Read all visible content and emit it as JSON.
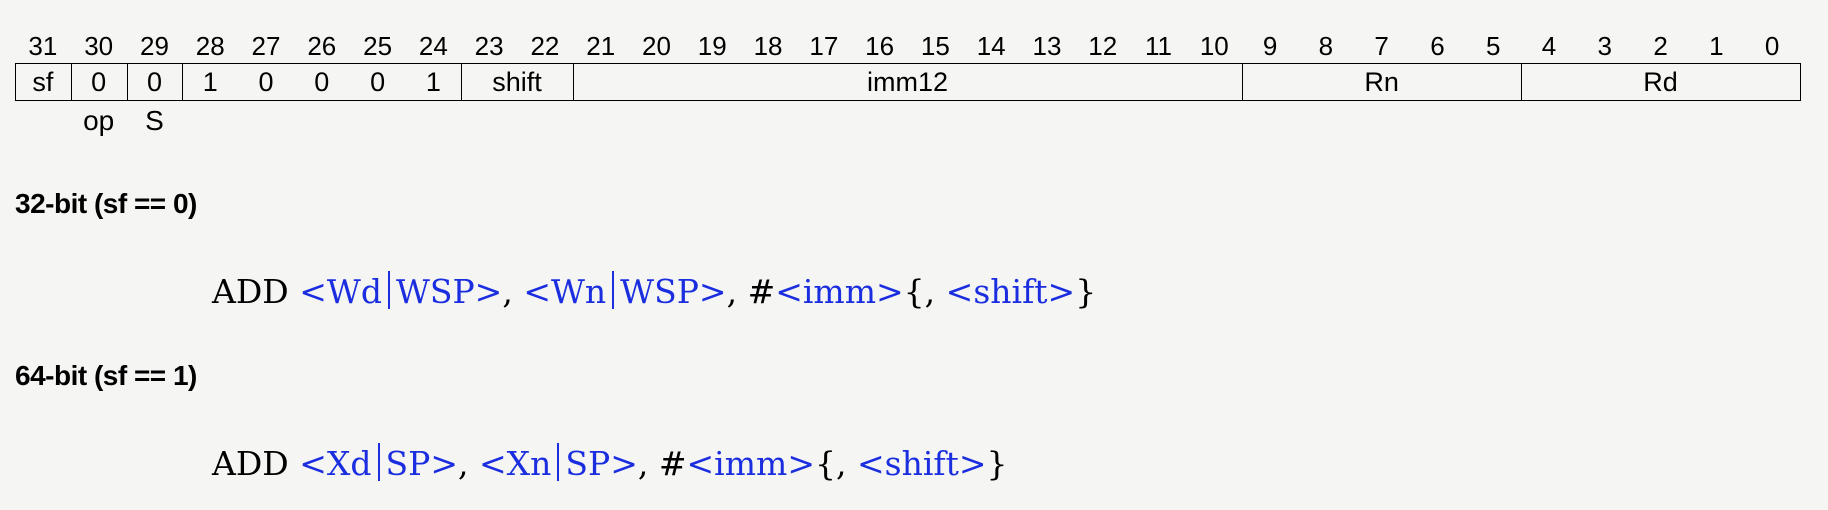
{
  "bit_numbers": [
    "31",
    "30",
    "29",
    "28",
    "27",
    "26",
    "25",
    "24",
    "23",
    "22",
    "21",
    "20",
    "19",
    "18",
    "17",
    "16",
    "15",
    "14",
    "13",
    "12",
    "11",
    "10",
    "9",
    "8",
    "7",
    "6",
    "5",
    "4",
    "3",
    "2",
    "1",
    "0"
  ],
  "encoding_fields": [
    {
      "id": "sf",
      "label": "sf"
    },
    {
      "id": "op",
      "label": "0"
    },
    {
      "id": "s",
      "label": "0"
    },
    {
      "id": "b28",
      "label": "1"
    },
    {
      "id": "b27",
      "label": "0"
    },
    {
      "id": "b26",
      "label": "0"
    },
    {
      "id": "b25",
      "label": "0"
    },
    {
      "id": "b24",
      "label": "1"
    },
    {
      "id": "shift",
      "label": "shift"
    },
    {
      "id": "imm12",
      "label": "imm12"
    },
    {
      "id": "rn",
      "label": "Rn"
    },
    {
      "id": "rd",
      "label": "Rd"
    }
  ],
  "field_sublabels": {
    "op": "op",
    "s": "S"
  },
  "variants": [
    {
      "heading": "32-bit (sf == 0)",
      "syntax": {
        "mnemonic": "ADD",
        "rd_a": "<Wd",
        "rd_b": "WSP>",
        "sep1": ",",
        "rn_a": "<Wn",
        "rn_b": "WSP>",
        "sep2": ",",
        "hash": "#",
        "imm": "<imm>",
        "opt_open": "{,",
        "shift": "<shift>",
        "opt_close": "}"
      }
    },
    {
      "heading": "64-bit (sf == 1)",
      "syntax": {
        "mnemonic": "ADD",
        "rd_a": "<Xd",
        "rd_b": "SP>",
        "sep1": ",",
        "rn_a": "<Xn",
        "rn_b": "SP>",
        "sep2": ",",
        "hash": "#",
        "imm": "<imm>",
        "opt_open": "{,",
        "shift": "<shift>",
        "opt_close": "}"
      }
    }
  ],
  "colors": {
    "operand": "#1a2ee0",
    "text": "#000000",
    "background": "#f5f5f3"
  }
}
